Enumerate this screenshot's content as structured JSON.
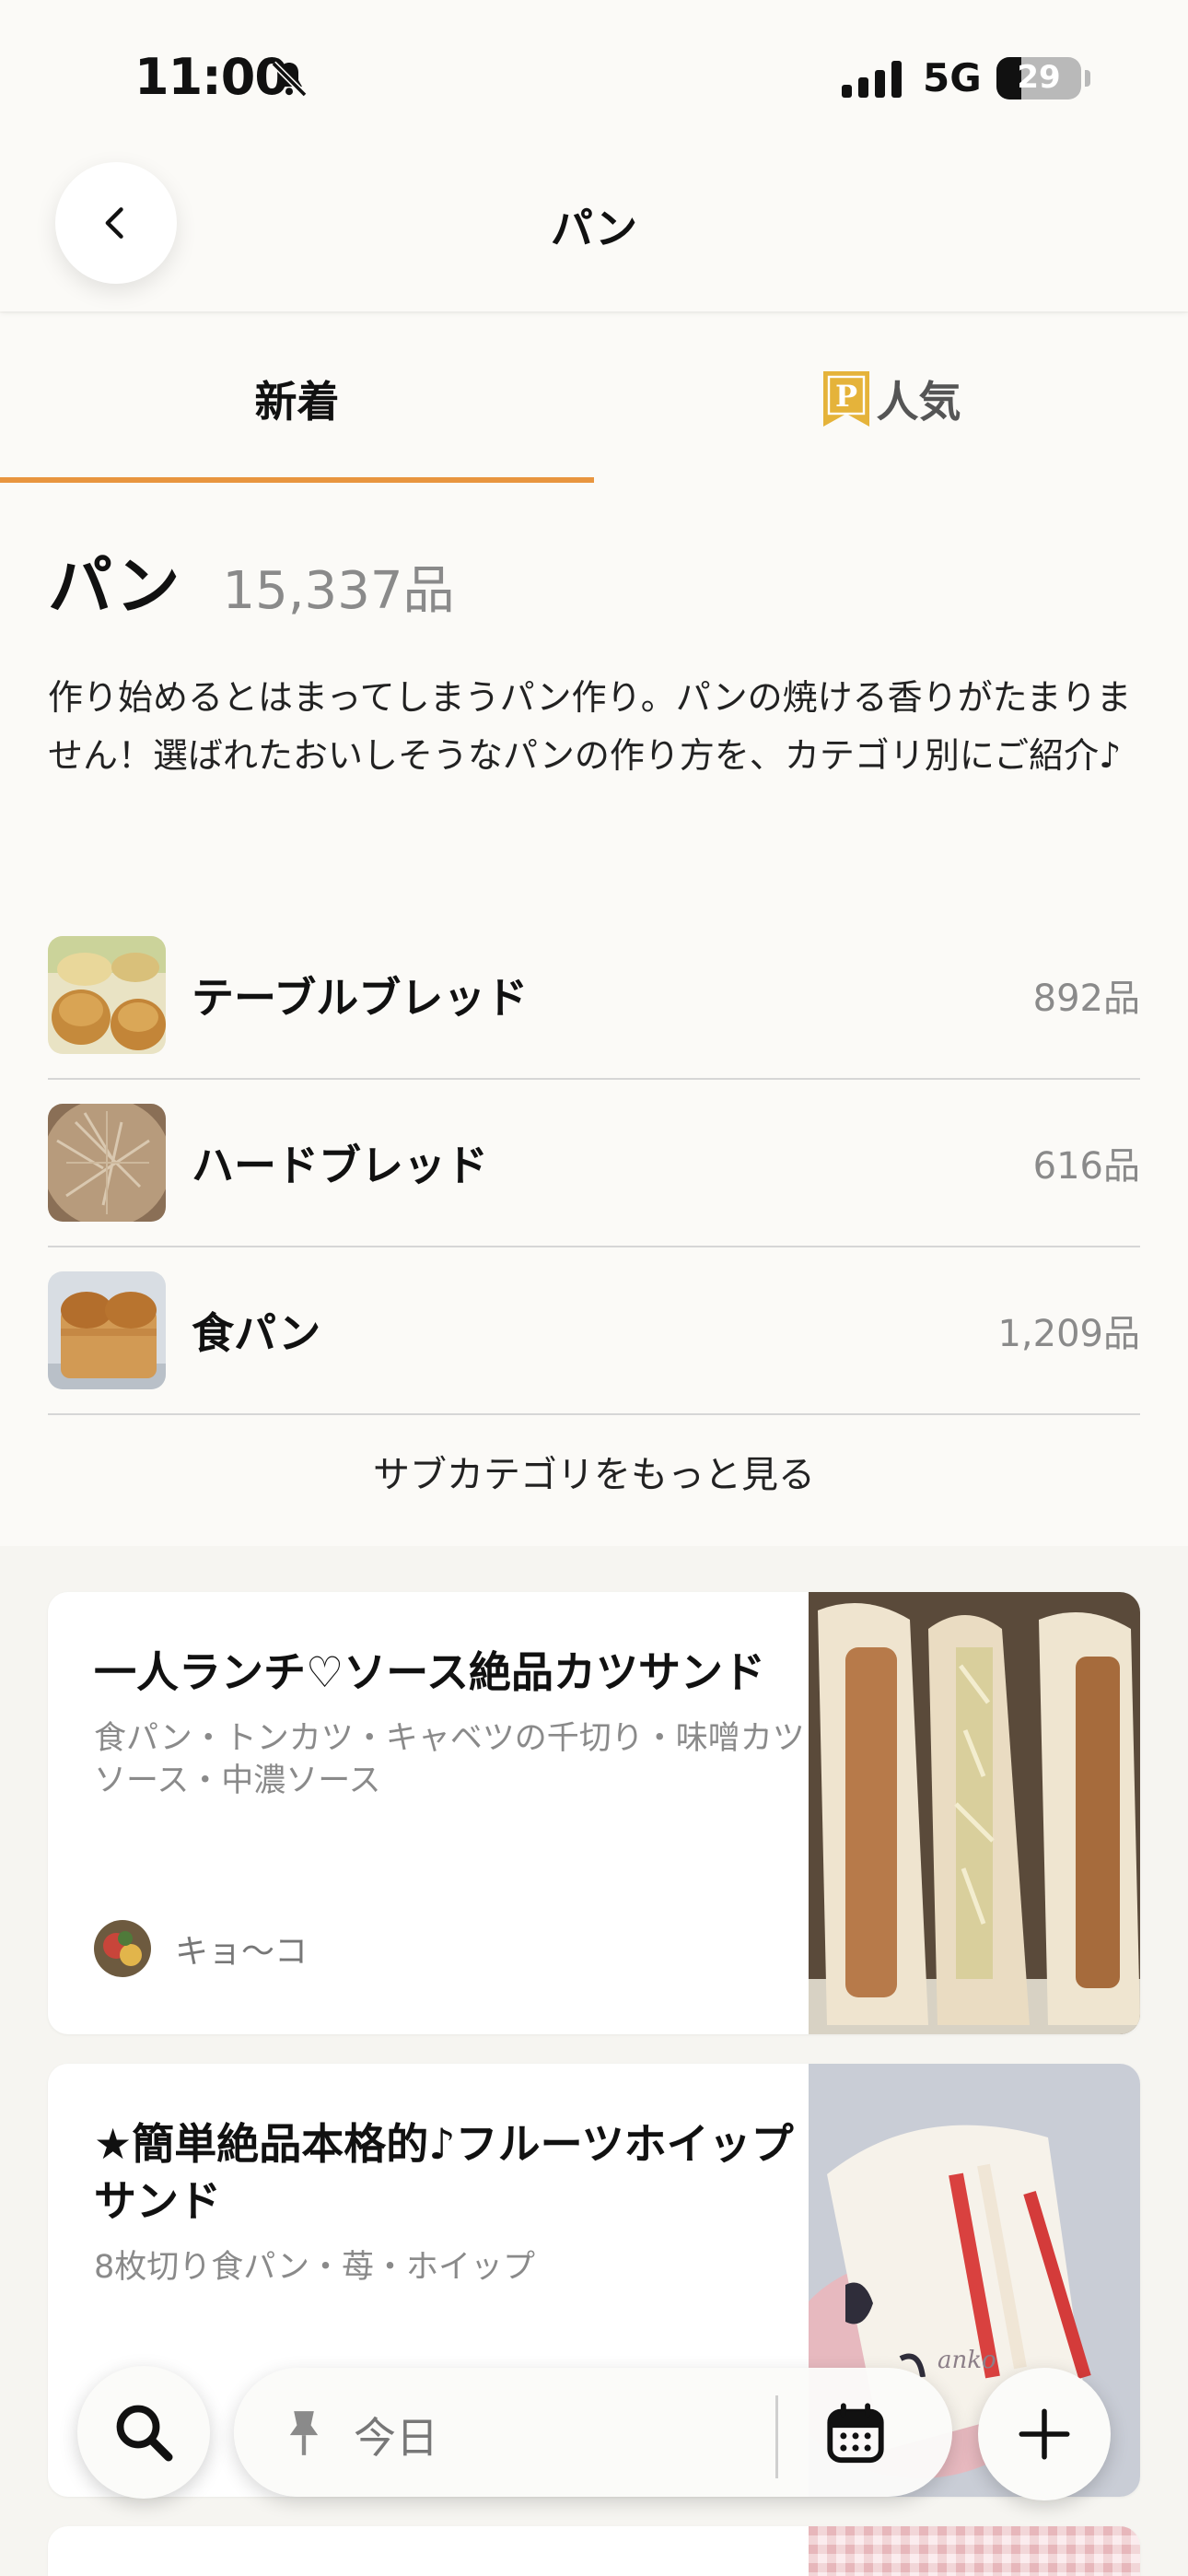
{
  "status_bar": {
    "time": "11:00",
    "network": "5G",
    "battery": "29"
  },
  "nav": {
    "title": "パン"
  },
  "tabs": {
    "new": "新着",
    "popular": "人気",
    "premium_badge": "P"
  },
  "category": {
    "title": "パン",
    "count": "15,337品",
    "description": "作り始めるとはまってしまうパン作り。パンの焼ける香りがたまりません！選ばれたおいしそうなパンの作り方を、カテゴリ別にご紹介♪",
    "subcategories": [
      {
        "name": "テーブルブレッド",
        "count": "892品"
      },
      {
        "name": "ハードブレッド",
        "count": "616品"
      },
      {
        "name": "食パン",
        "count": "1,209品"
      }
    ],
    "more_label": "サブカテゴリをもっと見る"
  },
  "recipes": [
    {
      "title": "一人ランチ♡ソース絶品カツサンド",
      "ingredients": "食パン・トンカツ・キャベツの千切り・味噌カツソース・中濃ソース",
      "author": "キョ～コ"
    },
    {
      "title": "★簡単絶品本格的♪フルーツホイップサンド",
      "ingredients": "8枚切り食パン・苺・ホイップ",
      "author": "",
      "photo_watermark": "anko"
    }
  ],
  "bottom_bar": {
    "today_label": "今日"
  },
  "colors": {
    "accent": "#e8953f",
    "background": "#f6f5f1",
    "surface": "#fbfaf7"
  }
}
